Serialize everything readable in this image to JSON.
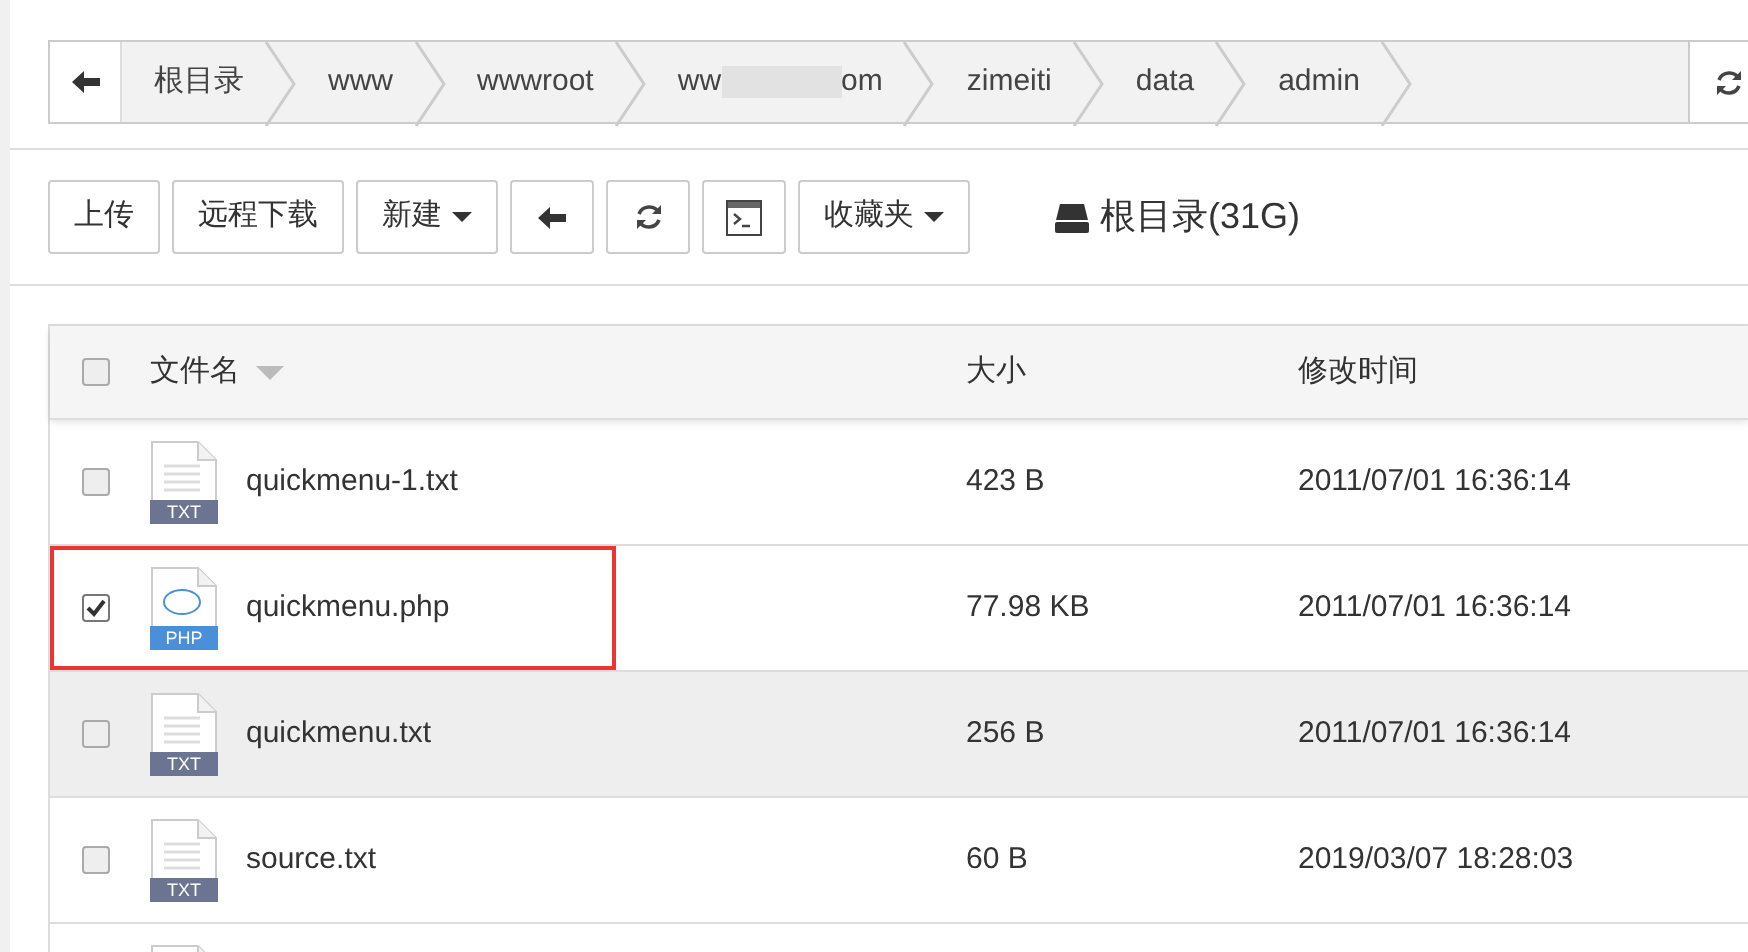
{
  "breadcrumb": {
    "crumbs": [
      {
        "label": "根目录"
      },
      {
        "label": "www"
      },
      {
        "label": "wwwroot"
      },
      {
        "label": "ww",
        "redacted": true,
        "label_end": "om"
      },
      {
        "label": "zimeiti"
      },
      {
        "label": "data"
      },
      {
        "label": "admin"
      }
    ]
  },
  "toolbar": {
    "buttons": [
      {
        "kind": "text",
        "label": "上传"
      },
      {
        "kind": "text",
        "label": "远程下载"
      },
      {
        "kind": "dropdown",
        "label": "新建"
      },
      {
        "kind": "back"
      },
      {
        "kind": "refresh"
      },
      {
        "kind": "terminal"
      },
      {
        "kind": "dropdown",
        "label": "收藏夹"
      }
    ],
    "disk": "根目录(31G)"
  },
  "table": {
    "columns": [
      "文件名",
      "大小",
      "修改时间"
    ],
    "all_checked": false,
    "rows": [
      {
        "kind": "file",
        "name": "quickmenu-1.txt",
        "badge": "TXT",
        "size": "423 B",
        "modified": "2011/07/01 16:36:14",
        "checked": false,
        "hovered": false,
        "highlighted": false
      },
      {
        "kind": "file",
        "name": "quickmenu.php",
        "badge": "PHP",
        "size": "77.98 KB",
        "modified": "2011/07/01 16:36:14",
        "checked": true,
        "hovered": false,
        "highlighted": true
      },
      {
        "kind": "file",
        "name": "quickmenu.txt",
        "badge": "TXT",
        "size": "256 B",
        "modified": "2011/07/01 16:36:14",
        "checked": false,
        "hovered": true,
        "highlighted": false
      },
      {
        "kind": "file",
        "name": "source.txt",
        "badge": "TXT",
        "size": "60 B",
        "modified": "2019/03/07 18:28:03",
        "checked": false,
        "hovered": false,
        "highlighted": false
      },
      {
        "kind": "cut"
      }
    ]
  }
}
